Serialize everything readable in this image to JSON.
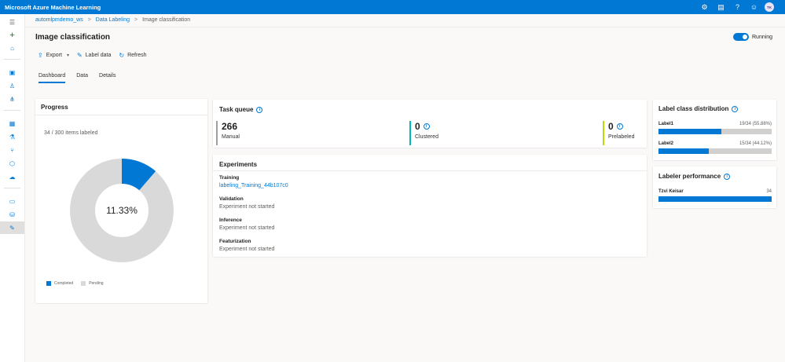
{
  "app": {
    "title": "Microsoft Azure Machine Learning",
    "user_initials": "TK"
  },
  "header_icons": [
    "gear-icon",
    "feedback-icon",
    "help-icon",
    "smiley-icon"
  ],
  "breadcrumb": {
    "workspace": "automlpmdemo_ws",
    "section": "Data Labeling",
    "current": "Image classification",
    "separator": ">"
  },
  "page": {
    "title": "Image classification",
    "status_label": "Running"
  },
  "toolbar": {
    "export_label": "Export",
    "label_data_label": "Label data",
    "refresh_label": "Refresh"
  },
  "tabs": [
    {
      "label": "Dashboard",
      "active": true
    },
    {
      "label": "Data",
      "active": false
    },
    {
      "label": "Details",
      "active": false
    }
  ],
  "progress": {
    "title": "Progress",
    "items_labeled_text": "34 / 300 items labeled",
    "percent_text": "11.33%",
    "completed_fraction": 0.1133,
    "legend_completed": "Completed",
    "legend_pending": "Pending",
    "colors": {
      "completed": "#0078d4",
      "pending": "#d9d9d9"
    }
  },
  "task_queue": {
    "title": "Task queue",
    "items": [
      {
        "value": "266",
        "label": "Manual",
        "color": "#a19f9d",
        "info": false
      },
      {
        "value": "0",
        "label": "Clustered",
        "color": "#00b7c3",
        "info": true
      },
      {
        "value": "0",
        "label": "Prelabeled",
        "color": "#bad80a",
        "info": true
      }
    ]
  },
  "experiments": {
    "title": "Experiments",
    "training_label": "Training",
    "training_link": "labeling_Training_44b107c0",
    "validation_label": "Validation",
    "validation_value": "Experiment not started",
    "inference_label": "Inference",
    "inference_value": "Experiment not started",
    "featurization_label": "Featurization",
    "featurization_value": "Experiment not started"
  },
  "label_distribution": {
    "title": "Label class distribution",
    "labels": [
      {
        "name": "Label1",
        "value": "19/34 (55.88%)",
        "fraction": 0.5588
      },
      {
        "name": "Label2",
        "value": "15/34 (44.12%)",
        "fraction": 0.4412
      }
    ]
  },
  "labeler_performance": {
    "title": "Labeler performance",
    "labelers": [
      {
        "name": "Tzvi Keisar",
        "count": "34",
        "fraction": 1.0
      }
    ]
  }
}
